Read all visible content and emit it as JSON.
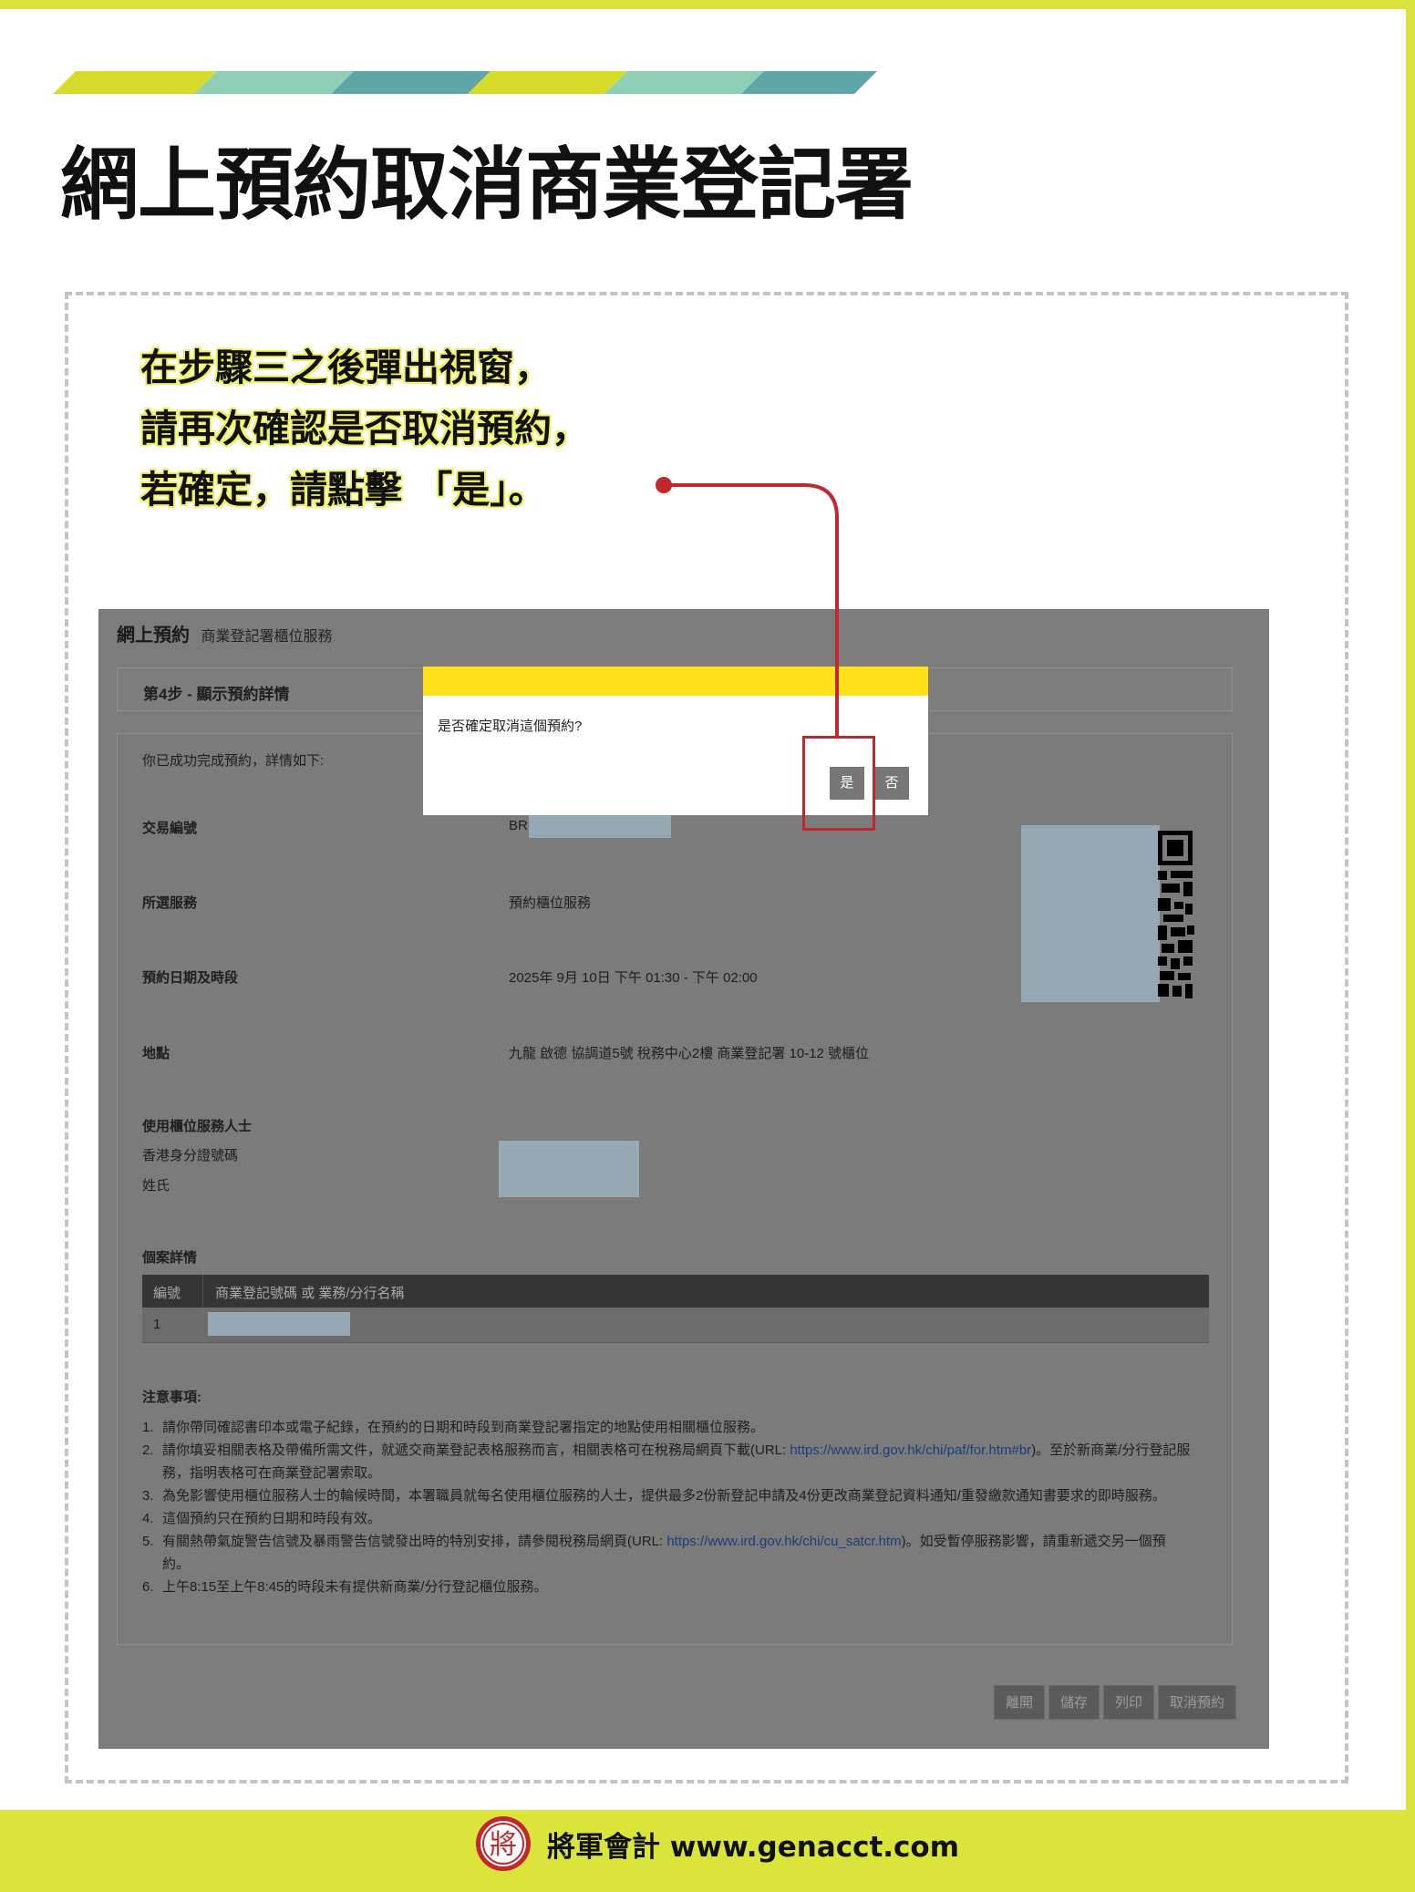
{
  "poster": {
    "title": "網上預約取消商業登記署",
    "instruction_lines": [
      "在步驟三之後彈出視窗，",
      "請再次確認是否取消預約，",
      "若確定，請點擊 「是」。"
    ],
    "stripe_colors": [
      "#d7dc2b",
      "#8fcfb6",
      "#5ea6a7"
    ],
    "accent_color": "#c0282e"
  },
  "screenshot": {
    "header_title": "網上預約",
    "header_subtitle": "商業登記署櫃位服務",
    "step_label": "第4步 - 顯示預約詳情",
    "intro": "你已成功完成預約，詳情如下:",
    "fields": {
      "transaction_label": "交易編號",
      "transaction_value": "BR",
      "service_label": "所選服務",
      "service_value": "預約櫃位服務",
      "datetime_label": "預約日期及時段",
      "datetime_value": "2025年 9月 10日 下午 01:30 - 下午 02:00",
      "location_label": "地點",
      "location_value": "九龍 啟德 協調道5號 稅務中心2樓 商業登記署 10-12 號櫃位",
      "user_label": "使用櫃位服務人士",
      "id_label": "香港身分證號碼",
      "surname_label": "姓氏"
    },
    "case_heading": "個案詳情",
    "table": {
      "headers": [
        "編號",
        "商業登記號碼 或 業務/分行名稱"
      ],
      "rows": [
        [
          "1",
          ""
        ]
      ]
    },
    "notes_heading": "注意事項:",
    "notes": [
      {
        "num": "1.",
        "text": "請你帶同確認書印本或電子紀錄，在預約的日期和時段到商業登記署指定的地點使用相關櫃位服務。"
      },
      {
        "num": "2.",
        "pre": "請你填妥相關表格及帶備所需文件，就遞交商業登記表格服務而言，相關表格可在稅務局網頁下載(URL: ",
        "link": "https://www.ird.gov.hk/chi/paf/for.htm#br",
        "post": ")。至於新商業/分行登記服務，指明表格可在商業登記署索取。"
      },
      {
        "num": "3.",
        "text": "為免影響使用櫃位服務人士的輪候時間，本署職員就每名使用櫃位服務的人士，提供最多2份新登記申請及4份更改商業登記資料通知/重發繳款通知書要求的即時服務。"
      },
      {
        "num": "4.",
        "text": "這個預約只在預約日期和時段有效。"
      },
      {
        "num": "5.",
        "pre": "有關熱帶氣旋警告信號及暴雨警告信號發出時的特別安排，請參閱稅務局網頁(URL: ",
        "link": "https://www.ird.gov.hk/chi/cu_satcr.htm",
        "post": ")。如受暫停服務影響，請重新遞交另一個預約。"
      },
      {
        "num": "6.",
        "text": "上午8:15至上午8:45的時段未有提供新商業/分行登記櫃位服務。"
      }
    ],
    "buttons": [
      "離開",
      "儲存",
      "列印",
      "取消預約"
    ]
  },
  "dialog": {
    "message": "是否確定取消這個預約?",
    "yes": "是",
    "no": "否",
    "bar_color": "#ffe11a"
  },
  "footer": {
    "logo_char": "將",
    "text": "將軍會計 www.genacct.com",
    "bg_color": "#dbe43a"
  }
}
